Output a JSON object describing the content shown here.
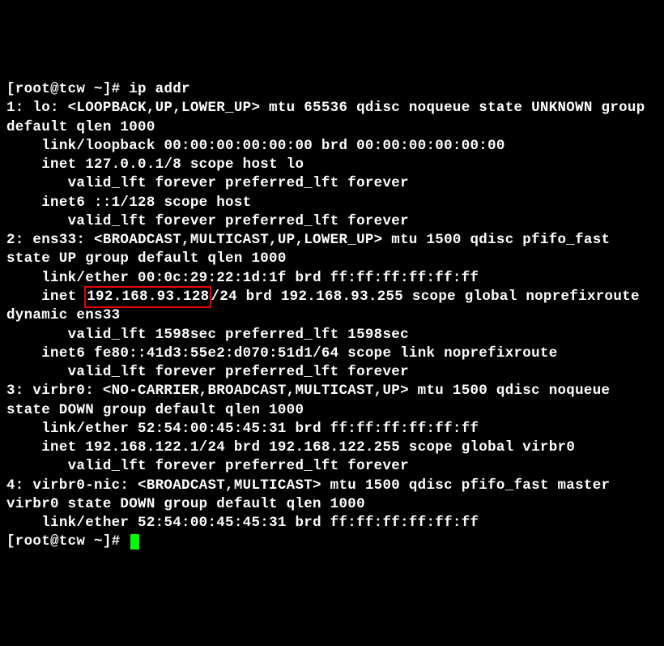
{
  "prompt1": "[root@tcw ~]# ",
  "command1": "ip addr",
  "l1": "1: lo: <LOOPBACK,UP,LOWER_UP> mtu 65536 qdisc noqueue state UNKNOWN group default qlen 1000",
  "l2": "    link/loopback 00:00:00:00:00:00 brd 00:00:00:00:00:00",
  "l3": "    inet 127.0.0.1/8 scope host lo",
  "l4": "       valid_lft forever preferred_lft forever",
  "l5": "    inet6 ::1/128 scope host ",
  "l6": "       valid_lft forever preferred_lft forever",
  "l7": "2: ens33: <BROADCAST,MULTICAST,UP,LOWER_UP> mtu 1500 qdisc pfifo_fast state UP group default qlen 1000",
  "l8": "    link/ether 00:0c:29:22:1d:1f brd ff:ff:ff:ff:ff:ff",
  "l9_pre": "    inet ",
  "highlight_ip": "192.168.93.128",
  "l9_post": "/24 brd 192.168.93.255 scope global noprefixroute dynamic ens33",
  "l10": "       valid_lft 1598sec preferred_lft 1598sec",
  "l11": "    inet6 fe80::41d3:55e2:d070:51d1/64 scope link noprefixroute ",
  "l12": "       valid_lft forever preferred_lft forever",
  "l13": "3: virbr0: <NO-CARRIER,BROADCAST,MULTICAST,UP> mtu 1500 qdisc noqueue state DOWN group default qlen 1000",
  "l14": "    link/ether 52:54:00:45:45:31 brd ff:ff:ff:ff:ff:ff",
  "l15": "    inet 192.168.122.1/24 brd 192.168.122.255 scope global virbr0",
  "l16": "       valid_lft forever preferred_lft forever",
  "l17": "4: virbr0-nic: <BROADCAST,MULTICAST> mtu 1500 qdisc pfifo_fast master virbr0 state DOWN group default qlen 1000",
  "l18": "    link/ether 52:54:00:45:45:31 brd ff:ff:ff:ff:ff:ff",
  "prompt2": "[root@tcw ~]# "
}
